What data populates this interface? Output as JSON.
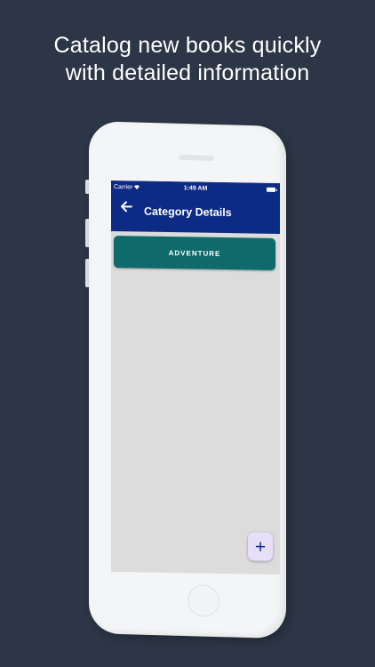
{
  "headline": {
    "line1": "Catalog new books quickly",
    "line2": "with detailed information"
  },
  "status_bar": {
    "carrier": "Carrier",
    "time": "1:49 AM",
    "wifi_icon": "wifi-icon",
    "battery_icon": "battery-icon"
  },
  "app_bar": {
    "title": "Category Details",
    "back_icon": "arrow-left-icon",
    "back_glyph": "←",
    "color": "#0d2a85"
  },
  "categories": [
    {
      "label": "ADVENTURE",
      "color": "#0f6b6b"
    }
  ],
  "fab": {
    "icon": "plus-icon",
    "glyph": "+",
    "background": "#e6dff7"
  },
  "colors": {
    "page_background": "#2c3646",
    "screen_background": "#dcdcdc"
  }
}
